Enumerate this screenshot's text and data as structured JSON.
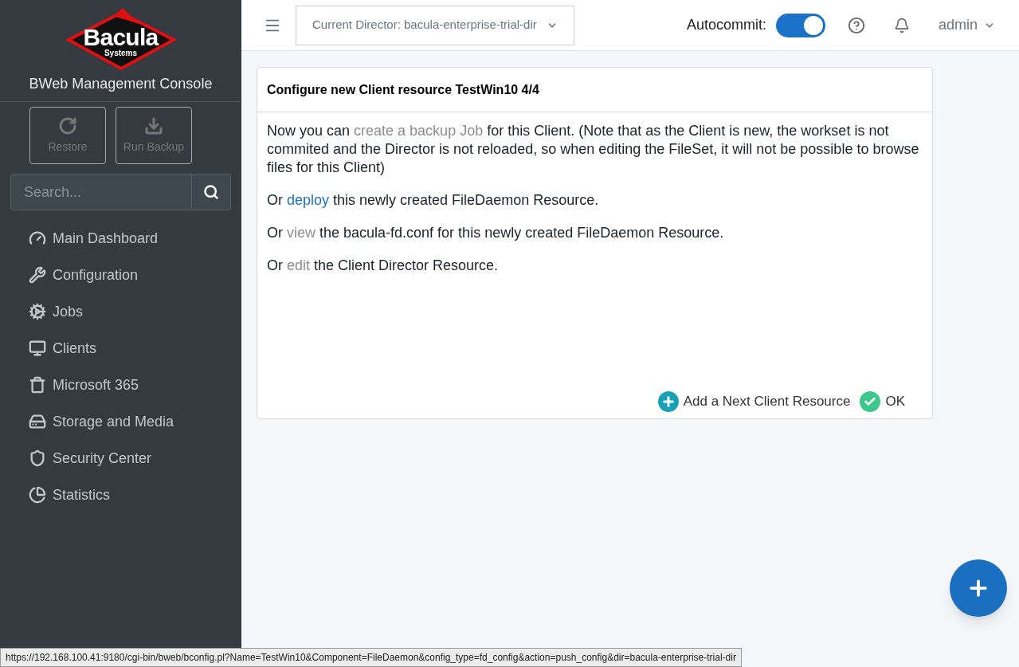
{
  "logo": {
    "word": "Bacula",
    "sub": "Systems"
  },
  "sidebar": {
    "title": "BWeb Management Console",
    "actions": [
      {
        "label": "Restore",
        "disabled": true
      },
      {
        "label": "Run Backup",
        "disabled": true
      }
    ],
    "search": {
      "placeholder": "Search..."
    },
    "items": [
      {
        "label": "Main Dashboard"
      },
      {
        "label": "Configuration"
      },
      {
        "label": "Jobs"
      },
      {
        "label": "Clients"
      },
      {
        "label": "Microsoft 365"
      },
      {
        "label": "Storage and Media"
      },
      {
        "label": "Security Center"
      },
      {
        "label": "Statistics"
      }
    ]
  },
  "header": {
    "director": "Current Director: bacula-enterprise-trial-dir",
    "autocommit": {
      "label": "Autocommit:",
      "on": true
    },
    "user": "admin"
  },
  "card": {
    "title": "Configure new Client resource TestWin10 4/4",
    "paragraphs": [
      [
        {
          "kind": "text",
          "text": "Now you can "
        },
        {
          "kind": "link",
          "text": "create a backup Job",
          "hovered": false
        },
        {
          "kind": "text",
          "text": " for this Client. (Note that as the Client is new, the workset is not commited and the Director is not reloaded, so when editing the FileSet, it will not be possible to browse files for this Client)"
        }
      ],
      [
        {
          "kind": "text",
          "text": "Or "
        },
        {
          "kind": "link",
          "text": "deploy",
          "hovered": true
        },
        {
          "kind": "text",
          "text": " this newly created FileDaemon Resource."
        }
      ],
      [
        {
          "kind": "text",
          "text": "Or "
        },
        {
          "kind": "link",
          "text": "view",
          "hovered": false
        },
        {
          "kind": "text",
          "text": " the bacula-fd.conf for this newly created FileDaemon Resource."
        }
      ],
      [
        {
          "kind": "text",
          "text": "Or "
        },
        {
          "kind": "link",
          "text": "edit",
          "hovered": false
        },
        {
          "kind": "text",
          "text": " the Client Director Resource."
        }
      ]
    ],
    "buttons": [
      {
        "kind": "add",
        "label": "Add a Next Client Resource"
      },
      {
        "kind": "ok",
        "label": "OK"
      }
    ]
  },
  "status_url": "https://192.168.100.41:9180/cgi-bin/bweb/bconfig.pl?Name=TestWin10&Component=FileDaemon&config_type=fd_config&action=push_config&dir=bacula-enterprise-trial-dir"
}
